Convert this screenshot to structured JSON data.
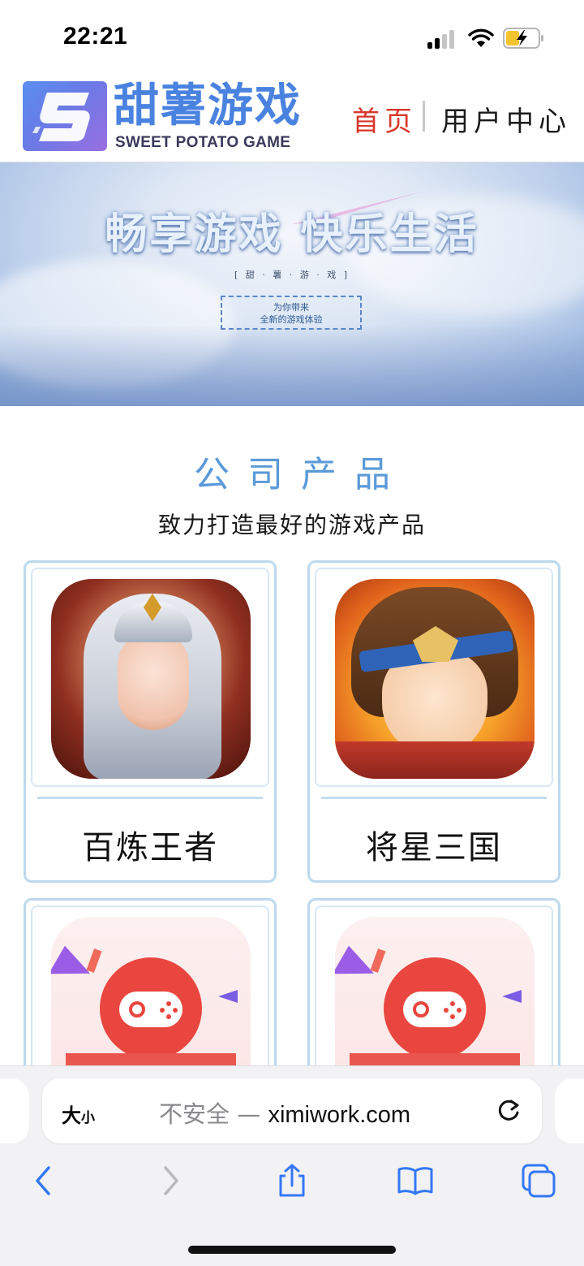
{
  "status_bar": {
    "time": "22:21"
  },
  "header": {
    "logo_title": "甜薯游戏",
    "logo_sub": "SWEET POTATO GAME",
    "nav": [
      {
        "label": "首页",
        "active": true,
        "color": "#d9362b"
      },
      {
        "label": "用户中心",
        "active": false
      }
    ]
  },
  "banner": {
    "headline": "畅享游戏  快乐生活",
    "tag": "[ 甜 · 薯 · 游 · 戏 ]",
    "box_line1": "为你带来",
    "box_line2": "全新的游戏体验"
  },
  "products": {
    "title": "公司产品",
    "subtitle": "致力打造最好的游戏产品",
    "items": [
      {
        "name": "百炼王者",
        "icon": "warrior-game-icon"
      },
      {
        "name": "将星三国",
        "icon": "hero-game-icon"
      },
      {
        "name": "",
        "icon": "gamepad-game-icon"
      },
      {
        "name": "",
        "icon": "gamepad-game-icon"
      }
    ]
  },
  "browser": {
    "text_size": "大小",
    "text_size_big": "大",
    "text_size_small": "小",
    "insecure_label": "不安全 — ",
    "domain": "ximiwork.com"
  },
  "colors": {
    "accent": "#5a9ad8",
    "brand_blue": "#4a82e0",
    "active_nav": "#d9362b",
    "card_border": "#bcd9ee"
  }
}
